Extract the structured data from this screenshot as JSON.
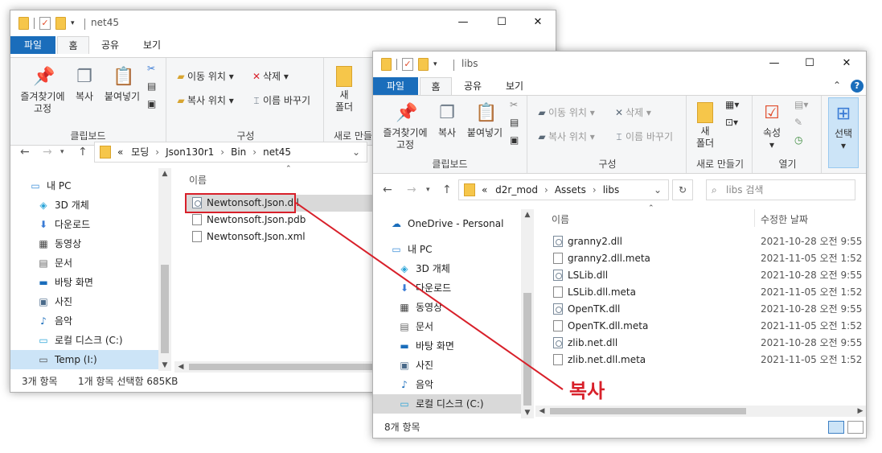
{
  "accent_color": "#1a6dbb",
  "annotation_color": "#d8202a",
  "window_back": {
    "title": "net45",
    "tabs": {
      "file": "파일",
      "home": "홈",
      "share": "공유",
      "view": "보기"
    },
    "ribbon": {
      "pin_label_1": "즐겨찾기에",
      "pin_label_2": "고정",
      "copy": "복사",
      "paste": "붙여넣기",
      "clipboard_group": "클립보드",
      "move_to": "이동 위치",
      "copy_to": "복사 위치",
      "delete": "삭제",
      "rename": "이름 바꾸기",
      "organize_group": "구성",
      "new_folder_1": "새",
      "new_folder_2": "폴더",
      "new_group": "새로 만들"
    },
    "address": {
      "prefix": "«",
      "parts": [
        "모딩",
        "Json130r1",
        "Bin",
        "net45"
      ]
    },
    "nav": [
      {
        "label": "내 PC",
        "icon": "pc-icon"
      },
      {
        "label": "3D 개체",
        "icon": "cube-icon"
      },
      {
        "label": "다운로드",
        "icon": "download-icon"
      },
      {
        "label": "동영상",
        "icon": "film-icon"
      },
      {
        "label": "문서",
        "icon": "document-icon"
      },
      {
        "label": "바탕 화면",
        "icon": "desktop-icon"
      },
      {
        "label": "사진",
        "icon": "picture-icon"
      },
      {
        "label": "음악",
        "icon": "music-icon"
      },
      {
        "label": "로컬 디스크 (C:)",
        "icon": "drive-icon"
      },
      {
        "label": "Temp (I:)",
        "icon": "drive-icon"
      }
    ],
    "column_name": "이름",
    "files": [
      "Newtonsoft.Json.dll",
      "Newtonsoft.Json.pdb",
      "Newtonsoft.Json.xml"
    ],
    "status": {
      "count": "3개 항목",
      "selected": "1개 항목 선택함 685KB"
    }
  },
  "window_front": {
    "title": "libs",
    "tabs": {
      "file": "파일",
      "home": "홈",
      "share": "공유",
      "view": "보기"
    },
    "ribbon": {
      "pin_label_1": "즐겨찾기에",
      "pin_label_2": "고정",
      "copy": "복사",
      "paste": "붙여넣기",
      "clipboard_group": "클립보드",
      "move_to": "이동 위치",
      "copy_to": "복사 위치",
      "delete": "삭제",
      "rename": "이름 바꾸기",
      "organize_group": "구성",
      "new_folder_1": "새",
      "new_folder_2": "폴더",
      "new_group": "새로 만들기",
      "properties": "속성",
      "open_group": "열기",
      "select": "선택"
    },
    "address": {
      "prefix": "«",
      "parts": [
        "d2r_mod",
        "Assets",
        "libs"
      ]
    },
    "search_placeholder": "libs 검색",
    "nav": [
      {
        "label": "OneDrive - Personal",
        "icon": "cloud-icon"
      },
      {
        "label": "내 PC",
        "icon": "pc-icon"
      },
      {
        "label": "3D 개체",
        "icon": "cube-icon"
      },
      {
        "label": "다운로드",
        "icon": "download-icon"
      },
      {
        "label": "동영상",
        "icon": "film-icon"
      },
      {
        "label": "문서",
        "icon": "document-icon"
      },
      {
        "label": "바탕 화면",
        "icon": "desktop-icon"
      },
      {
        "label": "사진",
        "icon": "picture-icon"
      },
      {
        "label": "음악",
        "icon": "music-icon"
      },
      {
        "label": "로컬 디스크 (C:)",
        "icon": "drive-icon"
      }
    ],
    "column_name": "이름",
    "column_date": "수정한 날짜",
    "files": [
      {
        "name": "granny2.dll",
        "date": "2021-10-28 오전 9:55",
        "type": "dll"
      },
      {
        "name": "granny2.dll.meta",
        "date": "2021-11-05 오전 1:52",
        "type": "meta"
      },
      {
        "name": "LSLib.dll",
        "date": "2021-10-28 오전 9:55",
        "type": "dll"
      },
      {
        "name": "LSLib.dll.meta",
        "date": "2021-11-05 오전 1:52",
        "type": "meta"
      },
      {
        "name": "OpenTK.dll",
        "date": "2021-10-28 오전 9:55",
        "type": "dll"
      },
      {
        "name": "OpenTK.dll.meta",
        "date": "2021-11-05 오전 1:52",
        "type": "meta"
      },
      {
        "name": "zlib.net.dll",
        "date": "2021-10-28 오전 9:55",
        "type": "dll"
      },
      {
        "name": "zlib.net.dll.meta",
        "date": "2021-11-05 오전 1:52",
        "type": "meta"
      }
    ],
    "status": {
      "count": "8개 항목"
    }
  },
  "annotation": {
    "label": "복사"
  }
}
